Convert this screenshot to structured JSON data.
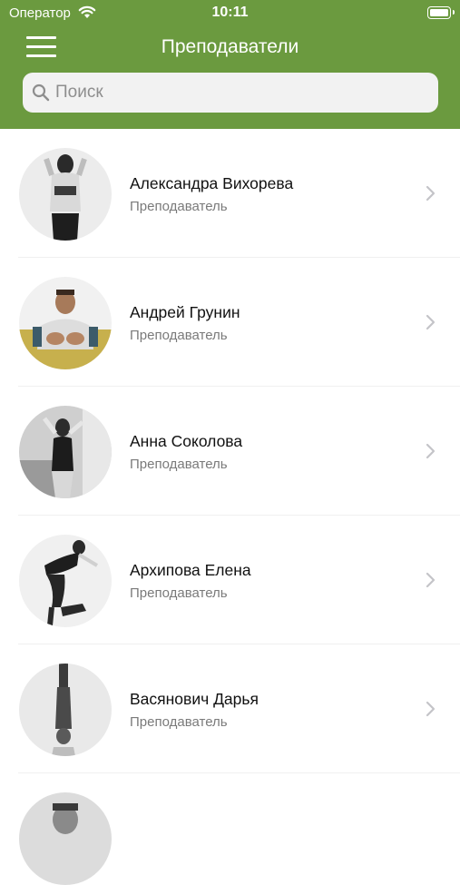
{
  "status_bar": {
    "carrier": "Оператор",
    "time": "10:11"
  },
  "header": {
    "title": "Преподаватели",
    "accent_color": "#6b9a3f"
  },
  "search": {
    "placeholder": "Поиск",
    "value": ""
  },
  "teachers": [
    {
      "name": "Александра Вихорева",
      "role": "Преподаватель"
    },
    {
      "name": "Андрей Грунин",
      "role": "Преподаватель"
    },
    {
      "name": "Анна Соколова",
      "role": "Преподаватель"
    },
    {
      "name": "Архипова Елена",
      "role": "Преподаватель"
    },
    {
      "name": "Васянович Дарья",
      "role": "Преподаватель"
    }
  ]
}
